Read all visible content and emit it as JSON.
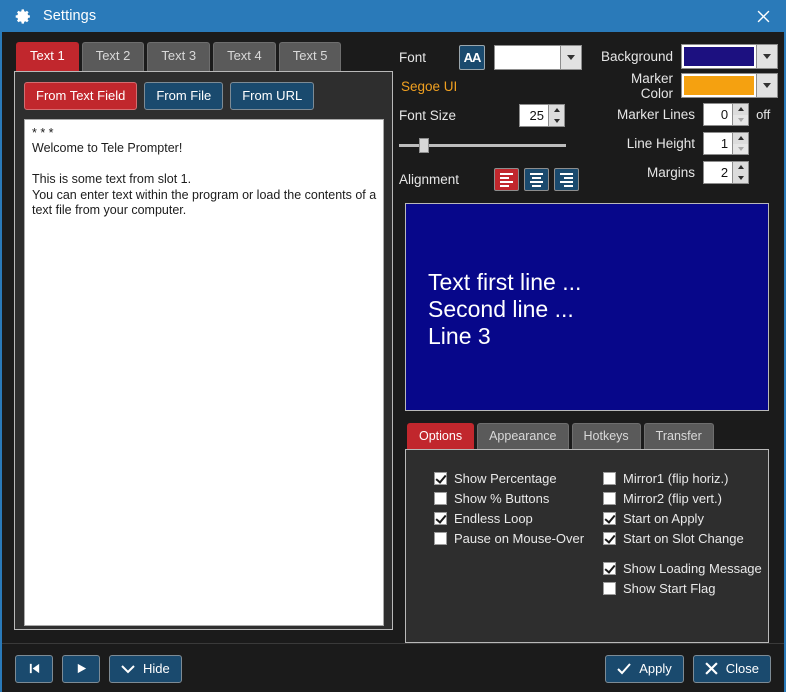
{
  "window": {
    "title": "Settings",
    "gear_icon": "gear-icon",
    "close_icon": "close-icon",
    "accent": "#2a7ab9",
    "background": "#1b1b1b",
    "selected_tab_color": "#c1272d",
    "button_color": "#1a4a6e"
  },
  "left": {
    "slot_tabs": [
      {
        "label": "Text 1",
        "active": true
      },
      {
        "label": "Text 2",
        "active": false
      },
      {
        "label": "Text 3",
        "active": false
      },
      {
        "label": "Text 4",
        "active": false
      },
      {
        "label": "Text 5",
        "active": false
      }
    ],
    "source_buttons": [
      {
        "label": "From Text Field",
        "active": true
      },
      {
        "label": "From File",
        "active": false
      },
      {
        "label": "From URL",
        "active": false
      }
    ],
    "text_content": "* * *\nWelcome to Tele Prompter!\n\nThis is some text from slot 1.\nYou can enter text within the program or load the contents of a\ntext file from your computer."
  },
  "font": {
    "label": "Font",
    "icon": "font-aa-icon",
    "selected_family": "",
    "family_display": "Segoe UI",
    "family_color": "#f0a020",
    "size_label": "Font Size",
    "size_value": "25",
    "alignment_label": "Alignment",
    "alignment_options": [
      {
        "name": "align-left",
        "active": true
      },
      {
        "name": "align-center",
        "active": false
      },
      {
        "name": "align-right",
        "active": false
      }
    ]
  },
  "colors": {
    "background_label": "Background",
    "background_value": "#1c1080",
    "marker_color_label": "Marker Color",
    "marker_color_value": "#f5a110"
  },
  "numeric": {
    "marker_lines_label": "Marker Lines",
    "marker_lines_value": "0",
    "marker_lines_state": "off",
    "line_height_label": "Line Height",
    "line_height_value": "1",
    "margins_label": "Margins",
    "margins_value": "2"
  },
  "preview": {
    "background": "#07078a",
    "text": "Text first line ...\nSecond line ...\nLine 3",
    "text_color": "#ffffff"
  },
  "options": {
    "tabs": [
      {
        "label": "Options",
        "active": true
      },
      {
        "label": "Appearance",
        "active": false
      },
      {
        "label": "Hotkeys",
        "active": false
      },
      {
        "label": "Transfer",
        "active": false
      }
    ],
    "column_left": [
      {
        "label": "Show Percentage",
        "checked": true
      },
      {
        "label": "Show % Buttons",
        "checked": false
      },
      {
        "label": "Endless Loop",
        "checked": true
      },
      {
        "label": "Pause on Mouse-Over",
        "checked": false
      }
    ],
    "column_right": [
      {
        "label": "Mirror1 (flip horiz.)",
        "checked": false
      },
      {
        "label": "Mirror2 (flip vert.)",
        "checked": false
      },
      {
        "label": "Start on Apply",
        "checked": true
      },
      {
        "label": "Start on Slot Change",
        "checked": true
      }
    ],
    "column_right_extra": [
      {
        "label": "Show Loading Message",
        "checked": true
      },
      {
        "label": "Show Start Flag",
        "checked": false
      }
    ]
  },
  "footer": {
    "rewind_icon": "skip-to-start-icon",
    "play_icon": "play-icon",
    "hide_icon": "chevron-down-icon",
    "hide_label": "Hide",
    "apply_icon": "check-icon",
    "apply_label": "Apply",
    "close_icon": "x-icon",
    "close_label": "Close"
  }
}
